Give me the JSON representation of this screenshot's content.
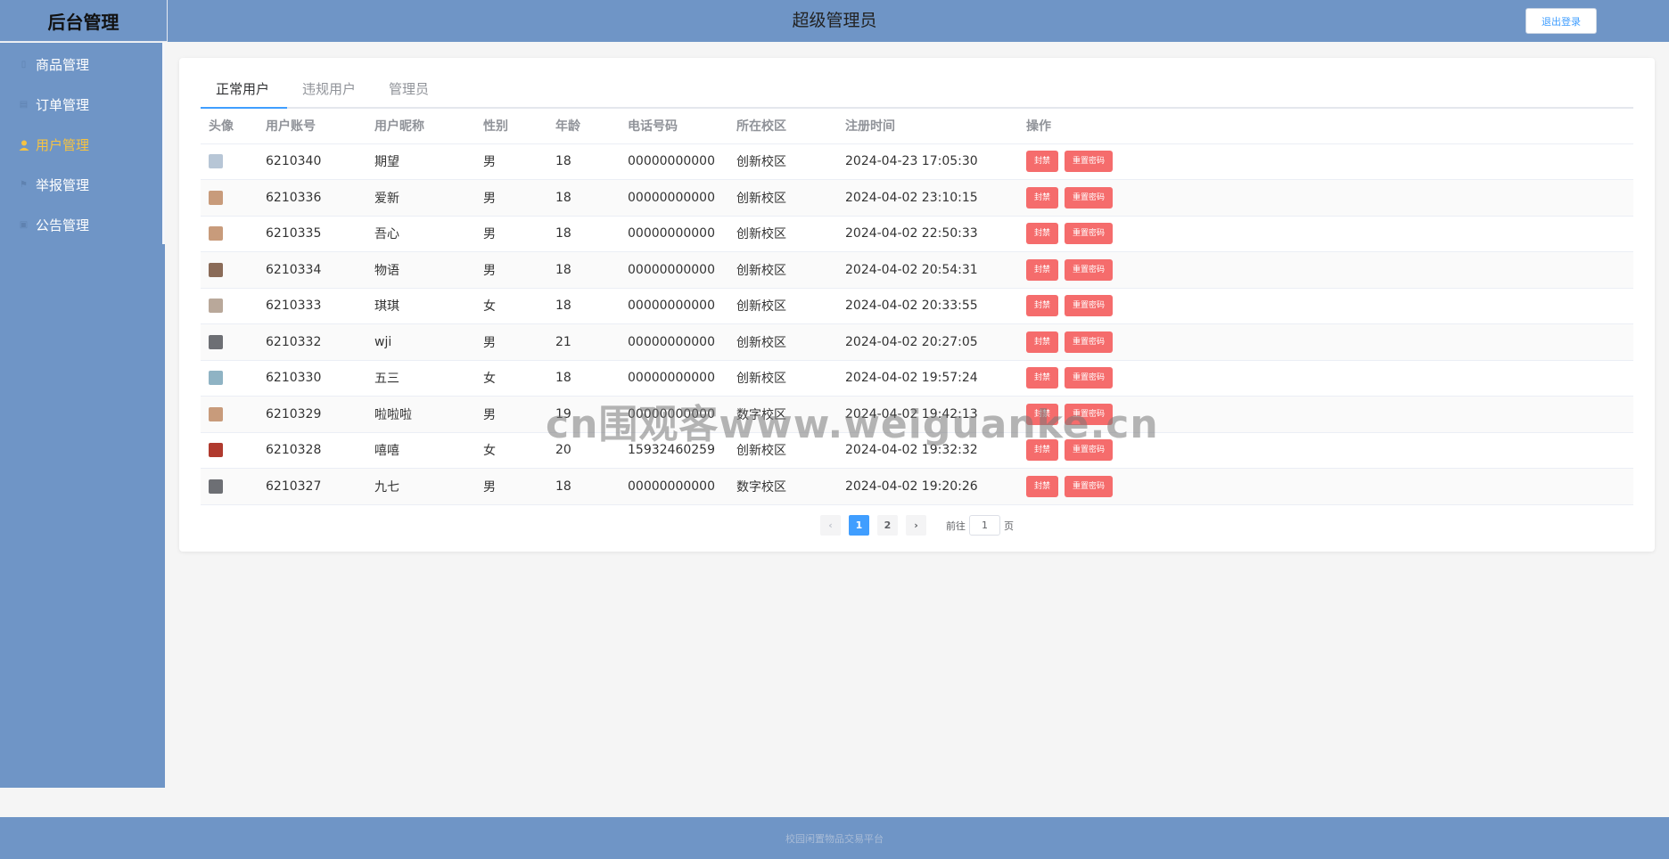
{
  "header": {
    "brand": "后台管理",
    "role": "超级管理员",
    "logout_label": "退出登录"
  },
  "sidebar": {
    "items": [
      {
        "label": "商品管理",
        "icon": "goods-icon",
        "active": false
      },
      {
        "label": "订单管理",
        "icon": "order-icon",
        "active": false
      },
      {
        "label": "用户管理",
        "icon": "user-icon",
        "active": true
      },
      {
        "label": "举报管理",
        "icon": "report-icon",
        "active": false
      },
      {
        "label": "公告管理",
        "icon": "notice-icon",
        "active": false
      }
    ]
  },
  "tabs": [
    {
      "label": "正常用户",
      "active": true
    },
    {
      "label": "违规用户",
      "active": false
    },
    {
      "label": "管理员",
      "active": false
    }
  ],
  "table": {
    "columns": [
      "头像",
      "用户账号",
      "用户昵称",
      "性别",
      "年龄",
      "电话号码",
      "所在校区",
      "注册时间",
      "操作"
    ],
    "actions": {
      "ban": "封禁",
      "reset": "重置密码"
    },
    "rows": [
      {
        "account": "6210340",
        "nickname": "期望",
        "gender": "男",
        "age": "18",
        "phone": "00000000000",
        "campus": "创新校区",
        "registered": "2024-04-23 17:05:30",
        "avatar_color": "#b7c6d6"
      },
      {
        "account": "6210336",
        "nickname": "爱新",
        "gender": "男",
        "age": "18",
        "phone": "00000000000",
        "campus": "创新校区",
        "registered": "2024-04-02 23:10:15",
        "avatar_color": "#c89b7b"
      },
      {
        "account": "6210335",
        "nickname": "吾心",
        "gender": "男",
        "age": "18",
        "phone": "00000000000",
        "campus": "创新校区",
        "registered": "2024-04-02 22:50:33",
        "avatar_color": "#c89b7b"
      },
      {
        "account": "6210334",
        "nickname": "物语",
        "gender": "男",
        "age": "18",
        "phone": "00000000000",
        "campus": "创新校区",
        "registered": "2024-04-02 20:54:31",
        "avatar_color": "#8a6b58"
      },
      {
        "account": "6210333",
        "nickname": "琪琪",
        "gender": "女",
        "age": "18",
        "phone": "00000000000",
        "campus": "创新校区",
        "registered": "2024-04-02 20:33:55",
        "avatar_color": "#b9a89a"
      },
      {
        "account": "6210332",
        "nickname": "wji",
        "gender": "男",
        "age": "21",
        "phone": "00000000000",
        "campus": "创新校区",
        "registered": "2024-04-02 20:27:05",
        "avatar_color": "#6d6f74"
      },
      {
        "account": "6210330",
        "nickname": "五三",
        "gender": "女",
        "age": "18",
        "phone": "00000000000",
        "campus": "创新校区",
        "registered": "2024-04-02 19:57:24",
        "avatar_color": "#8fb3c4"
      },
      {
        "account": "6210329",
        "nickname": "啦啦啦",
        "gender": "男",
        "age": "19",
        "phone": "00000000000",
        "campus": "数字校区",
        "registered": "2024-04-02 19:42:13",
        "avatar_color": "#c89b7b"
      },
      {
        "account": "6210328",
        "nickname": "嘻嘻",
        "gender": "女",
        "age": "20",
        "phone": "15932460259",
        "campus": "创新校区",
        "registered": "2024-04-02 19:32:32",
        "avatar_color": "#b03a2e"
      },
      {
        "account": "6210327",
        "nickname": "九七",
        "gender": "男",
        "age": "18",
        "phone": "00000000000",
        "campus": "数字校区",
        "registered": "2024-04-02 19:20:26",
        "avatar_color": "#6d6f74"
      }
    ]
  },
  "pagination": {
    "prev": "‹",
    "pages": [
      "1",
      "2"
    ],
    "current": "1",
    "next": "›",
    "goto_label": "前往",
    "goto_value": "1",
    "page_unit": "页"
  },
  "footer": {
    "text": "校园闲置物品交易平台"
  },
  "watermark": "cn围观客www.weiguanke.cn",
  "colors": {
    "theme": "#6f95c6",
    "accent": "#409eff",
    "danger": "#f56c6c",
    "active_nav": "#f6c342"
  }
}
